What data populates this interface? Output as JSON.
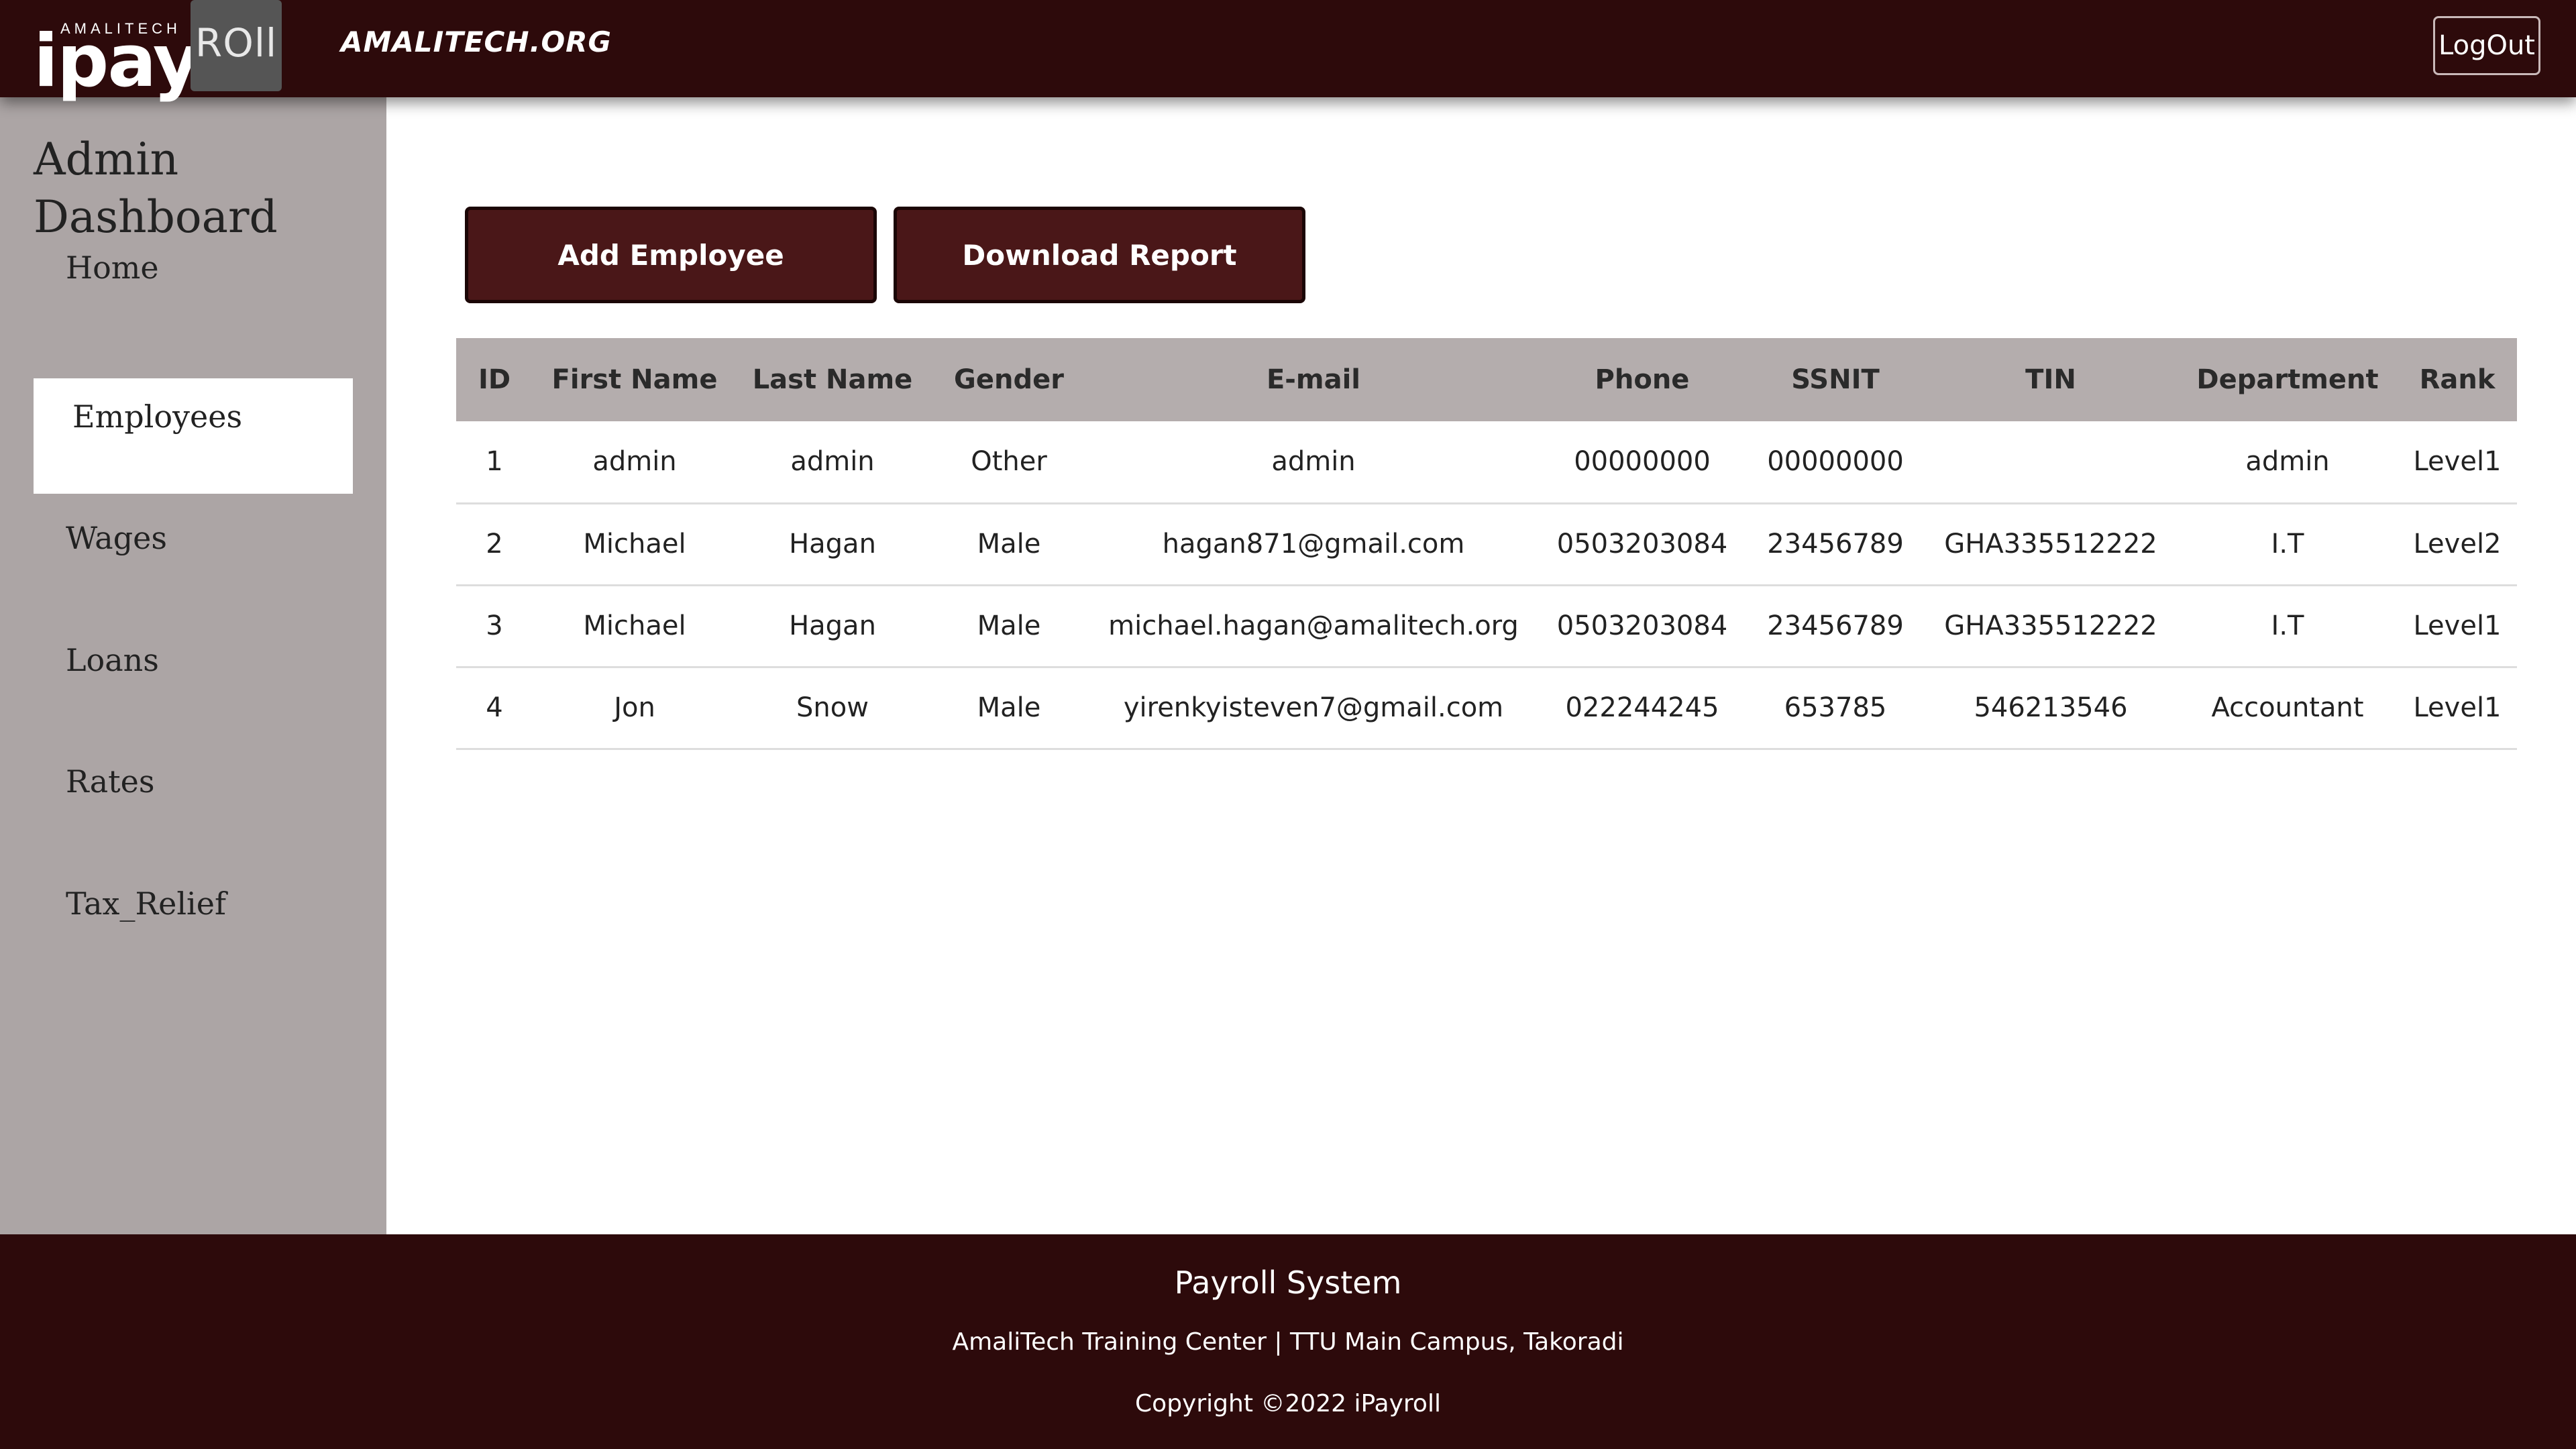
{
  "header": {
    "logo_small": "AMALITECH",
    "logo_main": "ipay",
    "logo_box": "ROll",
    "site_name": "AMALITECH.ORG",
    "logout_label": "LogOut"
  },
  "sidebar": {
    "title": "Admin Dashboard",
    "items": [
      {
        "label": "Home",
        "active": false
      },
      {
        "label": "Employees",
        "active": true
      },
      {
        "label": "Wages",
        "active": false
      },
      {
        "label": "Loans",
        "active": false
      },
      {
        "label": "Rates",
        "active": false
      },
      {
        "label": "Tax_Relief",
        "active": false
      }
    ]
  },
  "actions": {
    "add_employee": "Add Employee",
    "download_report": "Download Report"
  },
  "table": {
    "columns": [
      "ID",
      "First Name",
      "Last Name",
      "Gender",
      "E-mail",
      "Phone",
      "SSNIT",
      "TIN",
      "Department",
      "Rank"
    ],
    "rows": [
      [
        "1",
        "admin",
        "admin",
        "Other",
        "admin",
        "00000000",
        "00000000",
        "",
        "admin",
        "Level1"
      ],
      [
        "2",
        "Michael",
        "Hagan",
        "Male",
        "hagan871@gmail.com",
        "0503203084",
        "23456789",
        "GHA335512222",
        "I.T",
        "Level2"
      ],
      [
        "3",
        "Michael",
        "Hagan",
        "Male",
        "michael.hagan@amalitech.org",
        "0503203084",
        "23456789",
        "GHA335512222",
        "I.T",
        "Level1"
      ],
      [
        "4",
        "Jon",
        "Snow",
        "Male",
        "yirenkyisteven7@gmail.com",
        "022244245",
        "653785",
        "546213546",
        "Accountant",
        "Level1"
      ]
    ]
  },
  "footer": {
    "title": "Payroll System",
    "address": "AmaliTech Training Center | TTU Main Campus, Takoradi",
    "copyright": "Copyright ©2022 iPayroll"
  },
  "colors": {
    "header_bg": "#2d0a0b",
    "sidebar_bg": "#aca5a5",
    "button_bg": "#4a1718",
    "table_header_bg": "#b4adad"
  }
}
